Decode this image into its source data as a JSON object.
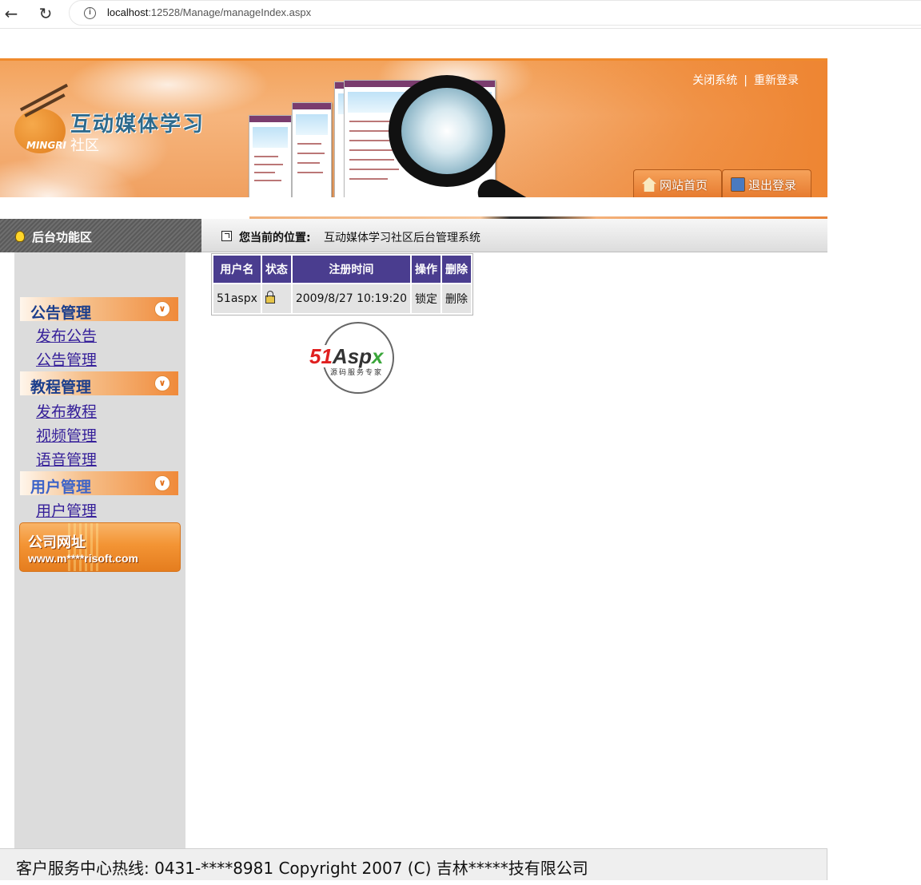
{
  "browser": {
    "url_host": "localhost",
    "url_rest": ":12528/Manage/manageIndex.aspx"
  },
  "header": {
    "logo_brand": "MINGRI",
    "site_title": "互动媒体学习",
    "site_subtitle": "社区",
    "top_links": [
      "关闭系统",
      "重新登录"
    ],
    "home_button": "网站首页",
    "logout_button": "退出登录",
    "accent_color": "#f08a2c"
  },
  "function_bar": {
    "title": "后台功能区",
    "location_label": "您当前的位置:",
    "location_path": "互动媒体学习社区后台管理系统"
  },
  "sidebar": {
    "groups": [
      {
        "title": "公告管理",
        "links": [
          "发布公告",
          "公告管理"
        ]
      },
      {
        "title": "教程管理",
        "links": [
          "发布教程",
          "视频管理",
          "语音管理"
        ]
      },
      {
        "title": "用户管理",
        "links": [
          "用户管理"
        ]
      }
    ],
    "company": {
      "title": "公司网址",
      "url": "www.m****risoft.com"
    }
  },
  "user_table": {
    "headers": [
      "用户名",
      "状态",
      "注册时间",
      "操作",
      "删除"
    ],
    "rows": [
      {
        "username": "51aspx",
        "status_icon": "lock-icon",
        "registered": "2009/8/27 10:19:20",
        "action": "锁定",
        "delete": "删除"
      }
    ],
    "header_color": "#4a3d8f"
  },
  "watermark": {
    "brand_51": "51",
    "brand_a": "Asp",
    "brand_x": "x",
    "slogan": "源码服务专家"
  },
  "footer": {
    "text": "客户服务中心热线:  0431-****8981 Copyright 2007 (C) 吉林*****技有限公司"
  }
}
